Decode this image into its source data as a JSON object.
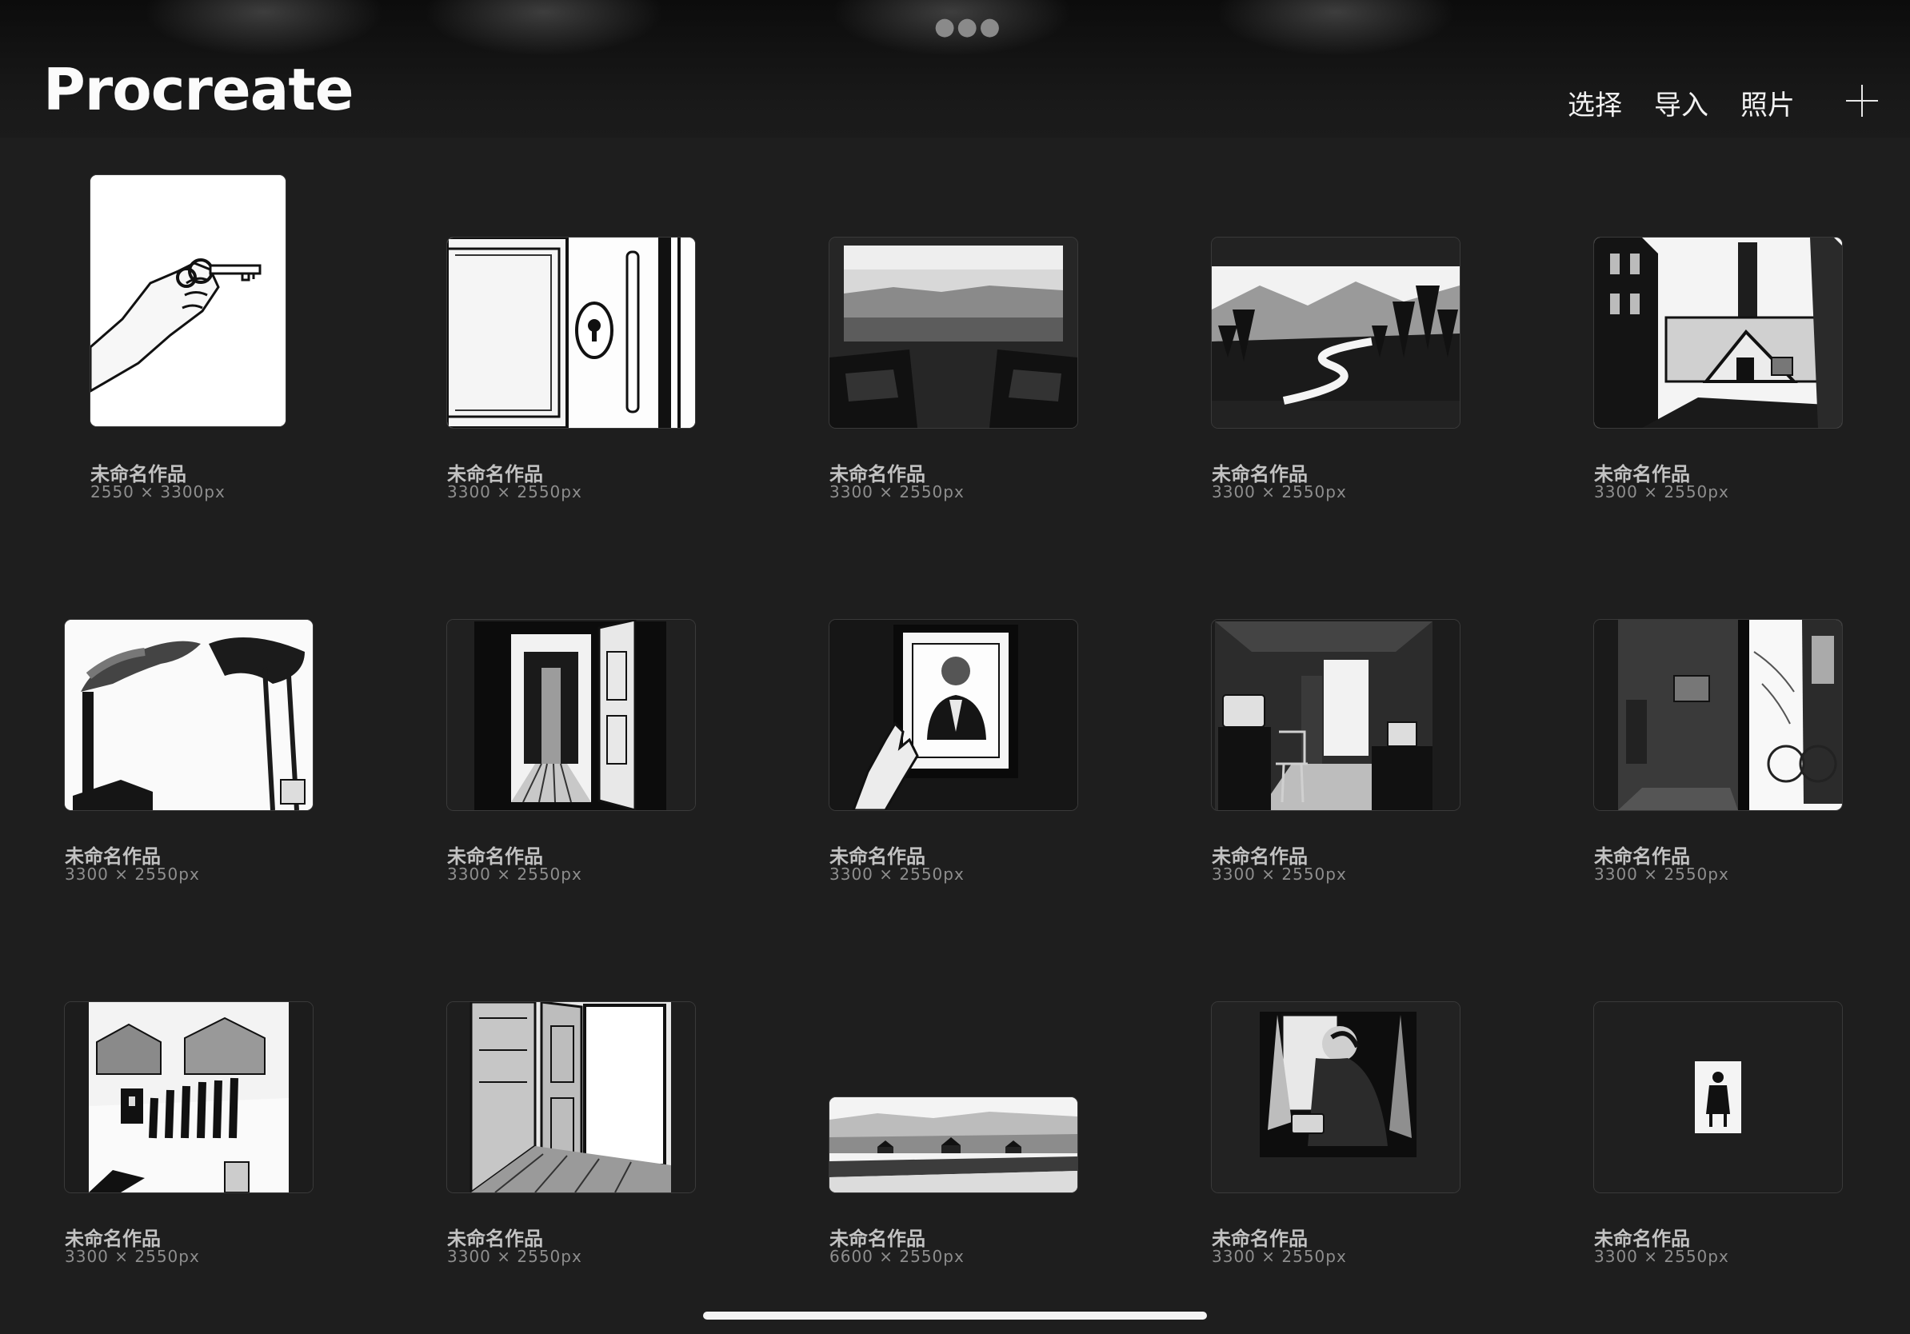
{
  "app": {
    "title": "Procreate"
  },
  "toolbar": {
    "select": "选择",
    "import": "导入",
    "photos": "照片",
    "add_icon": "plus-icon",
    "more_icon": "more-dots-icon"
  },
  "artworks": [
    {
      "title": "未命名作品",
      "size": "2550 × 3300px",
      "subject": "hand holding key"
    },
    {
      "title": "未命名作品",
      "size": "3300 × 2550px",
      "subject": "door with keyhole"
    },
    {
      "title": "未命名作品",
      "size": "3300 × 2550px",
      "subject": "train window fields"
    },
    {
      "title": "未命名作品",
      "size": "3300 × 2550px",
      "subject": "winding road forest"
    },
    {
      "title": "未命名作品",
      "size": "3300 × 2550px",
      "subject": "factory chimney courtyard"
    },
    {
      "title": "未命名作品",
      "size": "3300 × 2550px",
      "subject": "smoking chimney tree"
    },
    {
      "title": "未命名作品",
      "size": "3300 × 2550px",
      "subject": "open door corridor"
    },
    {
      "title": "未命名作品",
      "size": "3300 × 2550px",
      "subject": "hand touching portrait"
    },
    {
      "title": "未命名作品",
      "size": "3300 × 2550px",
      "subject": "old room with radio"
    },
    {
      "title": "未命名作品",
      "size": "3300 × 2550px",
      "subject": "doorway to bright yard"
    },
    {
      "title": "未命名作品",
      "size": "3300 × 2550px",
      "subject": "people at grave village"
    },
    {
      "title": "未命名作品",
      "size": "3300 × 2550px",
      "subject": "open door bright room"
    },
    {
      "title": "未命名作品",
      "size": "6600 × 2550px",
      "subject": "wide village landscape"
    },
    {
      "title": "未命名作品",
      "size": "3300 × 2550px",
      "subject": "woman on phone window"
    },
    {
      "title": "未命名作品",
      "size": "3300 × 2550px",
      "subject": "small standing figure"
    }
  ]
}
